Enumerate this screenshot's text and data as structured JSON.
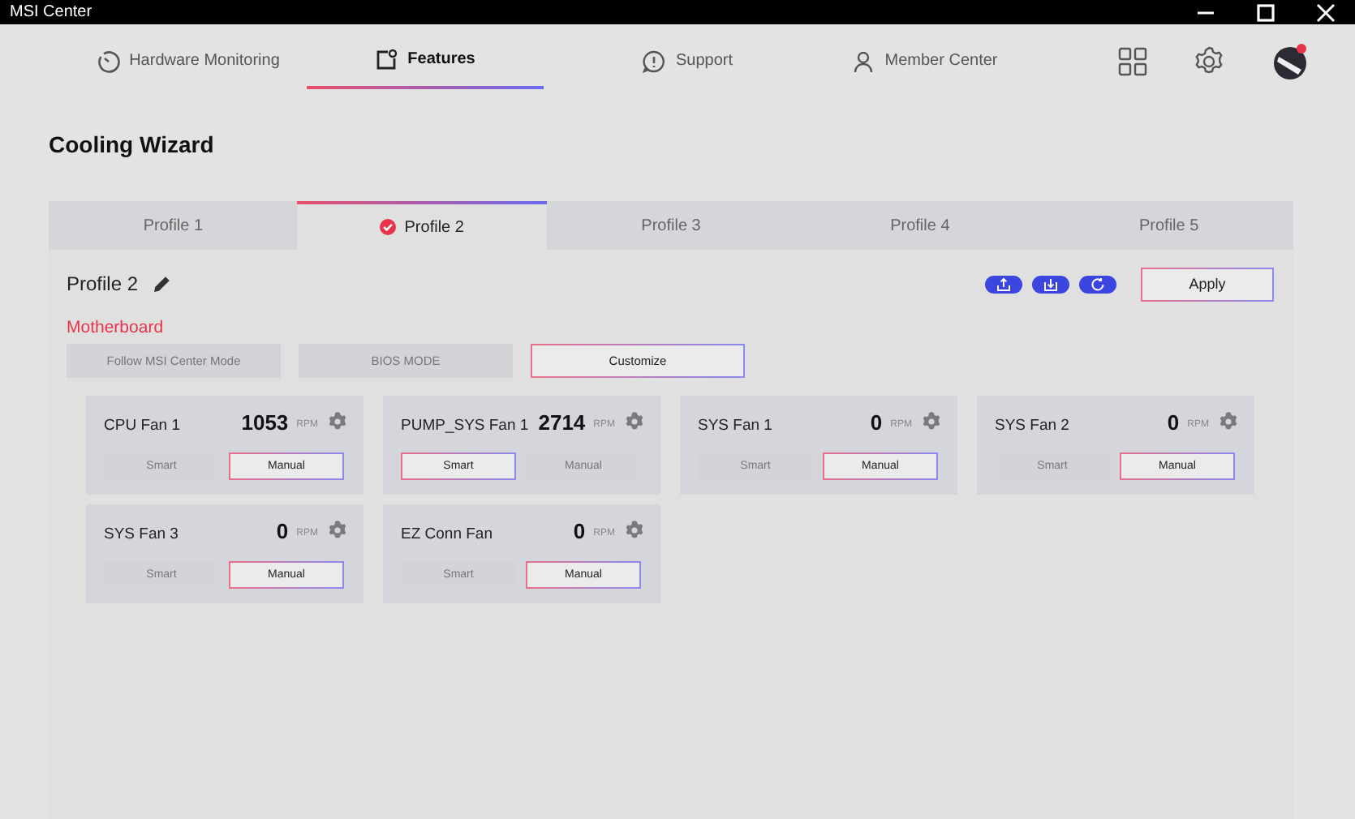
{
  "window": {
    "title": "MSI Center"
  },
  "nav": [
    {
      "label": "Hardware Monitoring",
      "kind": "gauge",
      "selected": false
    },
    {
      "label": "Features",
      "kind": "features",
      "selected": true
    },
    {
      "label": "Support",
      "kind": "support",
      "selected": false
    },
    {
      "label": "Member Center",
      "kind": "person",
      "selected": false
    }
  ],
  "page_title": "Cooling Wizard",
  "profiles": [
    {
      "label": "Profile 1",
      "selected": false
    },
    {
      "label": "Profile 2",
      "selected": true
    },
    {
      "label": "Profile 3",
      "selected": false
    },
    {
      "label": "Profile 4",
      "selected": false
    },
    {
      "label": "Profile 5",
      "selected": false
    }
  ],
  "profile_name": "Profile 2",
  "apply_button": "Apply",
  "section": "Motherboard",
  "modes": [
    {
      "label": "Follow MSI Center Mode",
      "selected": false
    },
    {
      "label": "BIOS MODE",
      "selected": false
    },
    {
      "label": "Customize",
      "selected": true
    }
  ],
  "fans": [
    {
      "name": "CPU Fan 1",
      "rpm": "1053",
      "unit": "RPM",
      "buttons": [
        {
          "label": "Smart",
          "selected": false
        },
        {
          "label": "Manual",
          "selected": true
        }
      ]
    },
    {
      "name": "PUMP_SYS Fan 1",
      "rpm": "2714",
      "unit": "RPM",
      "buttons": [
        {
          "label": "Smart",
          "selected": true
        },
        {
          "label": "Manual",
          "selected": false
        }
      ]
    },
    {
      "name": "SYS Fan 1",
      "rpm": "0",
      "unit": "RPM",
      "buttons": [
        {
          "label": "Smart",
          "selected": false
        },
        {
          "label": "Manual",
          "selected": true
        }
      ]
    },
    {
      "name": "SYS Fan 2",
      "rpm": "0",
      "unit": "RPM",
      "buttons": [
        {
          "label": "Smart",
          "selected": false
        },
        {
          "label": "Manual",
          "selected": true
        }
      ]
    },
    {
      "name": "SYS Fan 3",
      "rpm": "0",
      "unit": "RPM",
      "buttons": [
        {
          "label": "Smart",
          "selected": false
        },
        {
          "label": "Manual",
          "selected": true
        }
      ]
    },
    {
      "name": "EZ Conn Fan",
      "rpm": "0",
      "unit": "RPM",
      "buttons": [
        {
          "label": "Smart",
          "selected": false
        },
        {
          "label": "Manual",
          "selected": true
        }
      ]
    }
  ]
}
